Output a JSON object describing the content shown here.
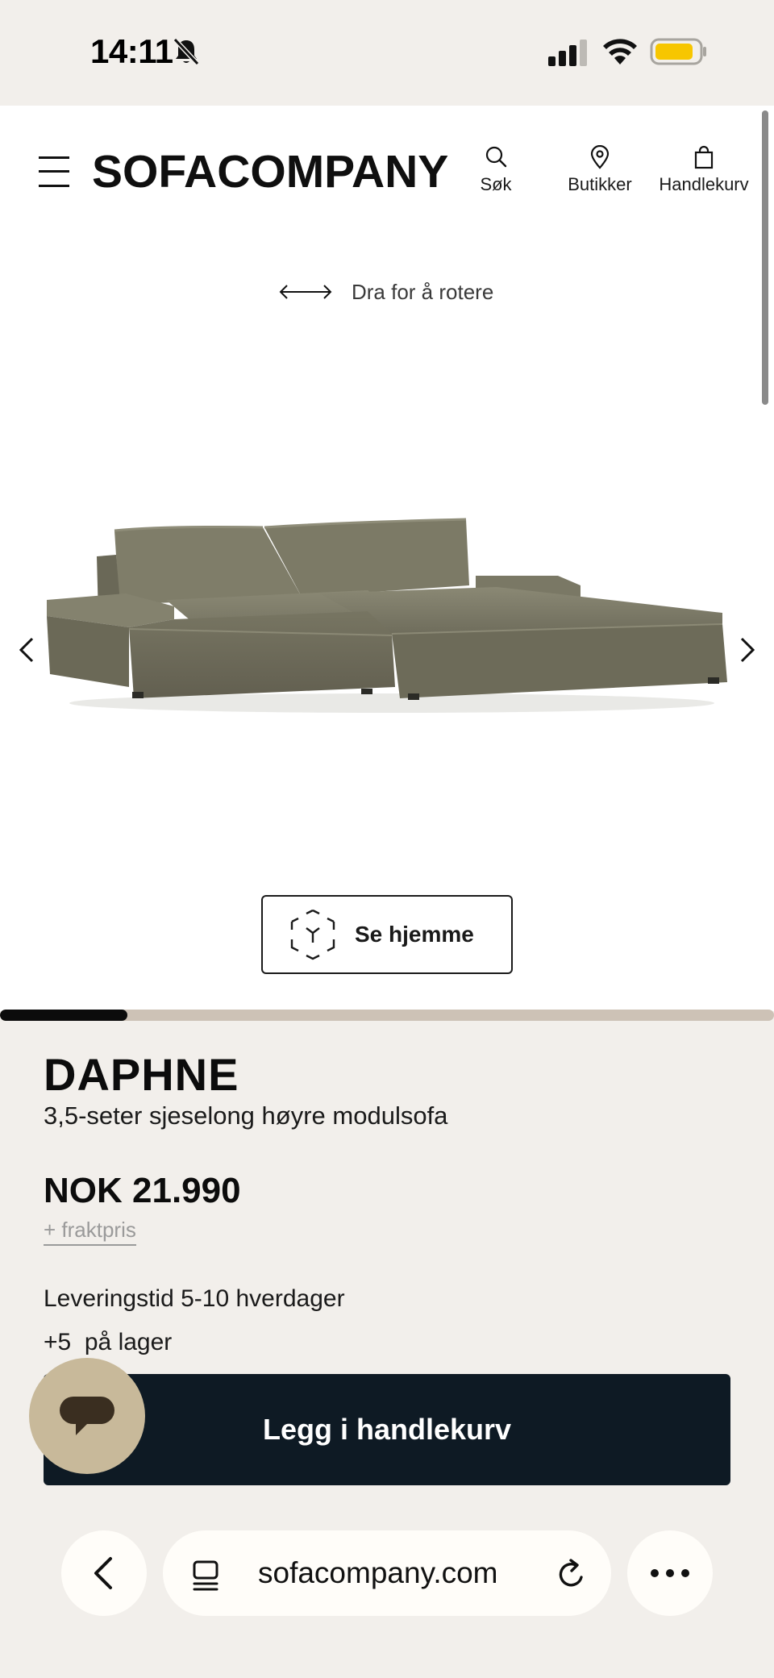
{
  "status_bar": {
    "time": "14:11"
  },
  "header": {
    "logo": "SOFACOMPANY",
    "nav": {
      "search": "Søk",
      "stores": "Butikker",
      "cart": "Handlekurv"
    }
  },
  "gallery": {
    "rotate_hint": "Dra for å rotere",
    "ar_button": "Se hjemme",
    "progress": 0.165
  },
  "product": {
    "name": "DAPHNE",
    "subtitle": "3,5-seter sjeselong høyre modulsofa",
    "price": "NOK 21.990",
    "shipping_link": "+ fraktpris",
    "delivery": "Leveringstid 5-10 hverdager",
    "stock": "+5  på lager",
    "add_to_cart": "Legg i handlekurv"
  },
  "browser": {
    "url": "sofacompany.com"
  },
  "colors": {
    "background": "#f2efeb",
    "cta": "#0e1a24",
    "chat": "#c8b99a",
    "sofa": "#7d7b69",
    "progress_track": "#cdc2b6"
  }
}
